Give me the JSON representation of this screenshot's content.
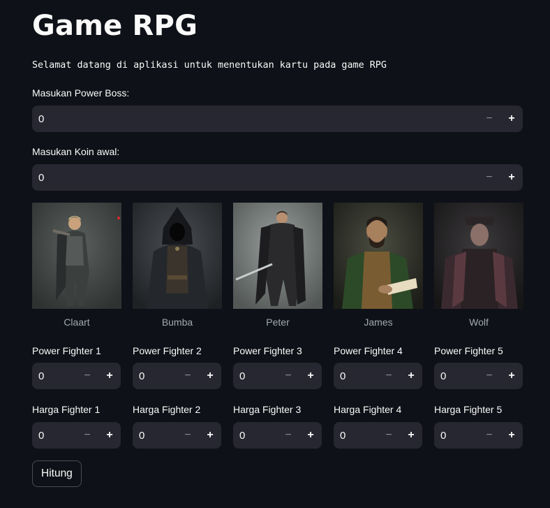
{
  "app": {
    "title": "Game RPG",
    "intro": "Selamat datang di aplikasi untuk menentukan kartu pada game RPG"
  },
  "boss": {
    "label": "Masukan Power Boss:",
    "value": "0"
  },
  "coin": {
    "label": "Masukan Koin awal:",
    "value": "0"
  },
  "stepper": {
    "minus": "−",
    "plus": "+"
  },
  "fighters": [
    {
      "name": "Claart",
      "power_label": "Power Fighter 1",
      "power_value": "0",
      "price_label": "Harga Fighter 1",
      "price_value": "0"
    },
    {
      "name": "Bumba",
      "power_label": "Power Fighter 2",
      "power_value": "0",
      "price_label": "Harga Fighter 2",
      "price_value": "0"
    },
    {
      "name": "Peter",
      "power_label": "Power Fighter 3",
      "power_value": "0",
      "price_label": "Harga Fighter 3",
      "price_value": "0"
    },
    {
      "name": "James",
      "power_label": "Power Fighter 4",
      "power_value": "0",
      "price_label": "Harga Fighter 4",
      "price_value": "0"
    },
    {
      "name": "Wolf",
      "power_label": "Power Fighter 5",
      "power_value": "0",
      "price_label": "Harga Fighter 5",
      "price_value": "0"
    }
  ],
  "action": {
    "button_label": "Hitung"
  },
  "colors": {
    "background": "#0e1117",
    "input_bg": "#262730",
    "text": "#fafafa",
    "caption": "#a3a8b4"
  }
}
